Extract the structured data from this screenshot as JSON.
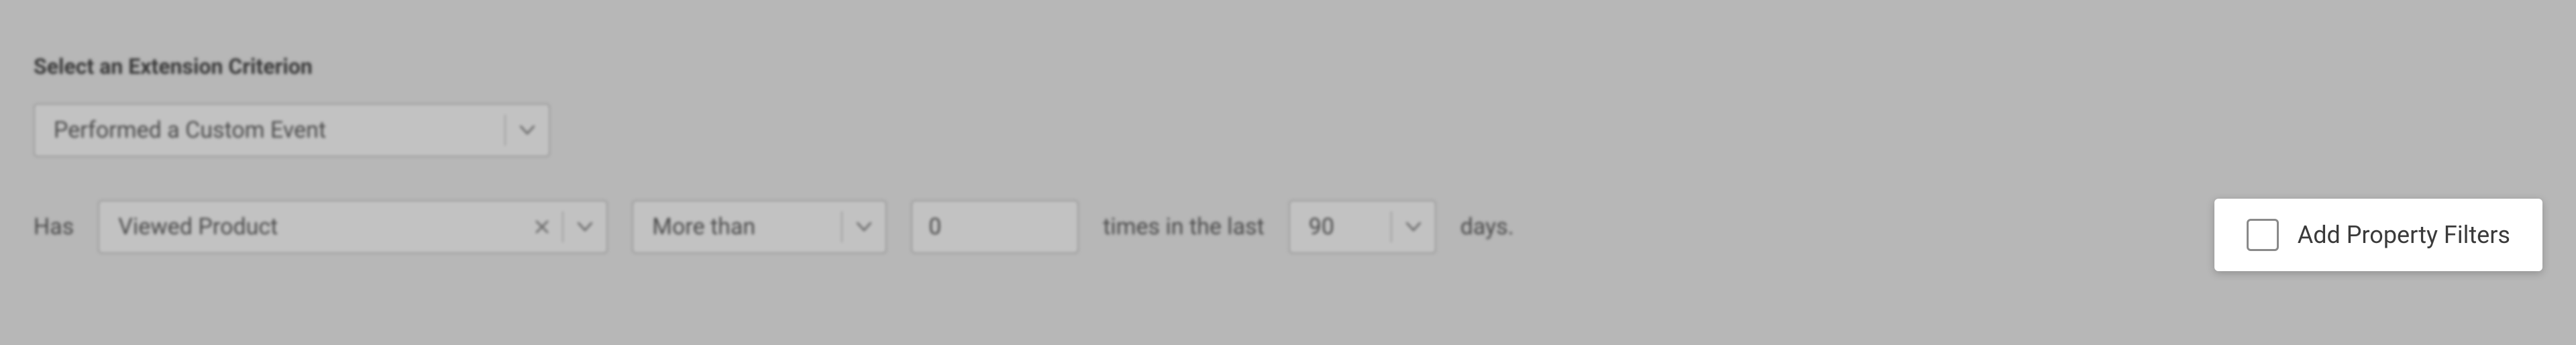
{
  "section": {
    "heading": "Select an Extension Criterion"
  },
  "criterion": {
    "selected": "Performed a Custom Event"
  },
  "rule": {
    "prefix": "Has",
    "event_selected": "Viewed Product",
    "comparator_selected": "More than",
    "count_value": "0",
    "middle_text": "times in the last",
    "days_value": "90",
    "suffix_text": "days."
  },
  "filters": {
    "checkbox_label": "Add Property Filters",
    "checked": false
  },
  "icons": {
    "chevron_down": "chevron-down-icon",
    "clear": "close-icon"
  }
}
